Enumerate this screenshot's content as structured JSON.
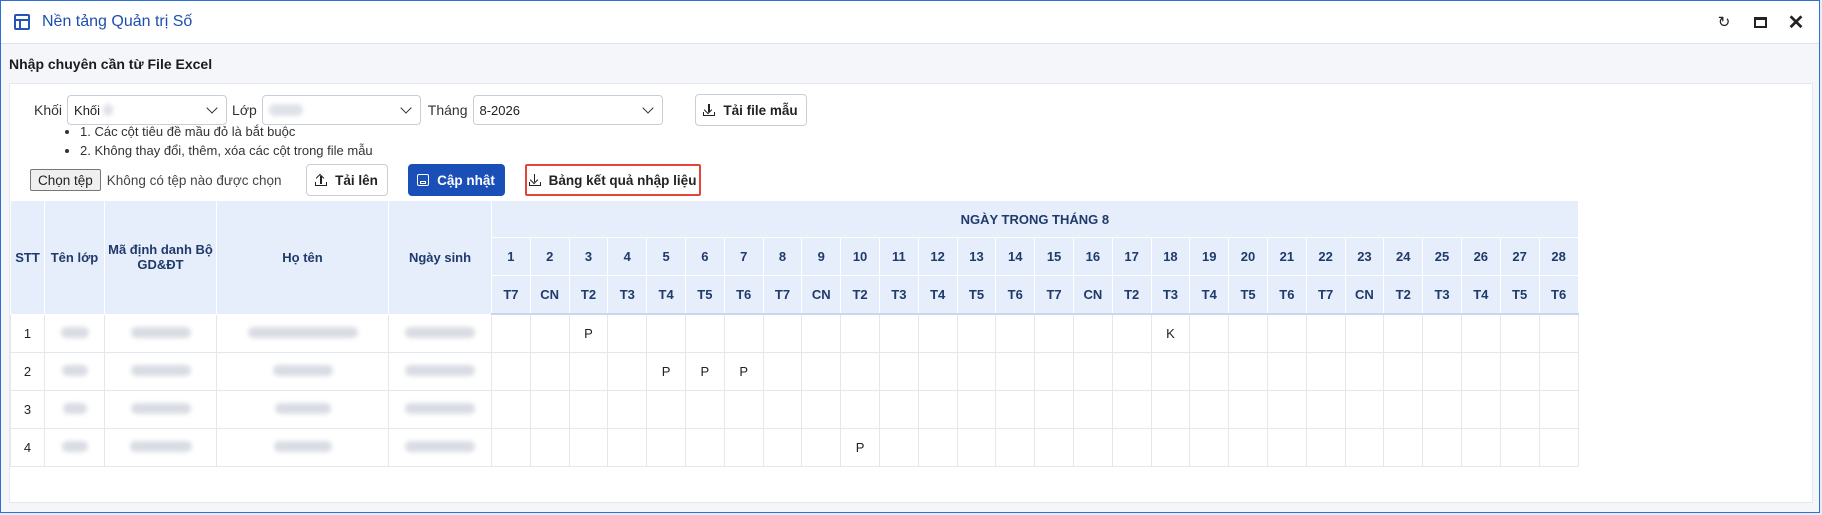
{
  "app": {
    "title": "Nền tảng Quản trị Số"
  },
  "page": {
    "heading": "Nhập chuyên cần từ File Excel"
  },
  "filters": {
    "khoi_label": "Khối",
    "khoi_value": "Khối",
    "lop_label": "Lớp",
    "lop_value": "",
    "thang_label": "Tháng",
    "thang_value": "8-2026",
    "download_template_label": "Tải file mẫu"
  },
  "notes": [
    "1. Các cột tiêu đề mầu đỏ là bắt buộc",
    "2. Không thay đổi, thêm, xóa các cột trong file mẫu"
  ],
  "actions": {
    "choose_file_label": "Chọn tệp",
    "no_file_text": "Không có tệp nào được chọn",
    "upload_label": "Tải lên",
    "update_label": "Cập nhật",
    "results_label": "Bảng kết quả nhập liệu"
  },
  "table": {
    "headers": {
      "stt": "STT",
      "class": "Tên lớp",
      "id": "Mã định danh Bộ GD&ĐT",
      "name": "Họ tên",
      "dob": "Ngày sinh",
      "days_group": "NGÀY TRONG THÁNG 8"
    },
    "days": [
      "1",
      "2",
      "3",
      "4",
      "5",
      "6",
      "7",
      "8",
      "9",
      "10",
      "11",
      "12",
      "13",
      "14",
      "15",
      "16",
      "17",
      "18",
      "19",
      "20",
      "21",
      "22",
      "23",
      "24",
      "25",
      "26",
      "27",
      "28"
    ],
    "weekdays": [
      "T7",
      "CN",
      "T2",
      "T3",
      "T4",
      "T5",
      "T6",
      "T7",
      "CN",
      "T2",
      "T3",
      "T4",
      "T5",
      "T6",
      "T7",
      "CN",
      "T2",
      "T3",
      "T4",
      "T5",
      "T6",
      "T7",
      "CN",
      "T2",
      "T3",
      "T4",
      "T5",
      "T6"
    ],
    "rows": [
      {
        "stt": "1",
        "marks": [
          "",
          "",
          "P",
          "",
          "",
          "",
          "",
          "",
          "",
          "",
          "",
          "",
          "",
          "",
          "",
          "",
          "",
          "K",
          "",
          "",
          "",
          "",
          "",
          "",
          "",
          "",
          "",
          ""
        ]
      },
      {
        "stt": "2",
        "marks": [
          "",
          "",
          "",
          "",
          "P",
          "P",
          "P",
          "",
          "",
          "",
          "",
          "",
          "",
          "",
          "",
          "",
          "",
          "",
          "",
          "",
          "",
          "",
          "",
          "",
          "",
          "",
          "",
          ""
        ]
      },
      {
        "stt": "3",
        "marks": [
          "",
          "",
          "",
          "",
          "",
          "",
          "",
          "",
          "",
          "",
          "",
          "",
          "",
          "",
          "",
          "",
          "",
          "",
          "",
          "",
          "",
          "",
          "",
          "",
          "",
          "",
          "",
          ""
        ]
      },
      {
        "stt": "4",
        "marks": [
          "",
          "",
          "",
          "",
          "",
          "",
          "",
          "",
          "",
          "P",
          "",
          "",
          "",
          "",
          "",
          "",
          "",
          "",
          "",
          "",
          "",
          "",
          "",
          "",
          "",
          "",
          "",
          ""
        ]
      }
    ]
  }
}
